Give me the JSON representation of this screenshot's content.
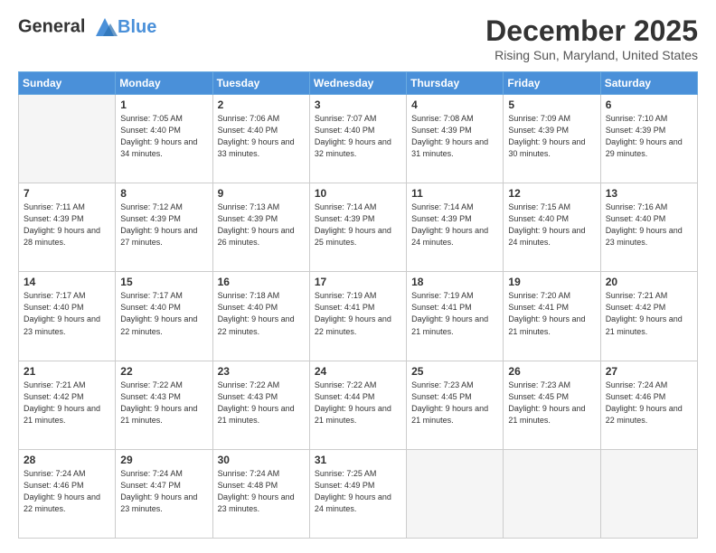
{
  "header": {
    "logo_line1": "General",
    "logo_line2": "Blue",
    "month_title": "December 2025",
    "location": "Rising Sun, Maryland, United States"
  },
  "weekdays": [
    "Sunday",
    "Monday",
    "Tuesday",
    "Wednesday",
    "Thursday",
    "Friday",
    "Saturday"
  ],
  "weeks": [
    [
      {
        "day": "",
        "empty": true
      },
      {
        "day": "1",
        "sunrise": "7:05 AM",
        "sunset": "4:40 PM",
        "daylight": "9 hours and 34 minutes."
      },
      {
        "day": "2",
        "sunrise": "7:06 AM",
        "sunset": "4:40 PM",
        "daylight": "9 hours and 33 minutes."
      },
      {
        "day": "3",
        "sunrise": "7:07 AM",
        "sunset": "4:40 PM",
        "daylight": "9 hours and 32 minutes."
      },
      {
        "day": "4",
        "sunrise": "7:08 AM",
        "sunset": "4:39 PM",
        "daylight": "9 hours and 31 minutes."
      },
      {
        "day": "5",
        "sunrise": "7:09 AM",
        "sunset": "4:39 PM",
        "daylight": "9 hours and 30 minutes."
      },
      {
        "day": "6",
        "sunrise": "7:10 AM",
        "sunset": "4:39 PM",
        "daylight": "9 hours and 29 minutes."
      }
    ],
    [
      {
        "day": "7",
        "sunrise": "7:11 AM",
        "sunset": "4:39 PM",
        "daylight": "9 hours and 28 minutes."
      },
      {
        "day": "8",
        "sunrise": "7:12 AM",
        "sunset": "4:39 PM",
        "daylight": "9 hours and 27 minutes."
      },
      {
        "day": "9",
        "sunrise": "7:13 AM",
        "sunset": "4:39 PM",
        "daylight": "9 hours and 26 minutes."
      },
      {
        "day": "10",
        "sunrise": "7:14 AM",
        "sunset": "4:39 PM",
        "daylight": "9 hours and 25 minutes."
      },
      {
        "day": "11",
        "sunrise": "7:14 AM",
        "sunset": "4:39 PM",
        "daylight": "9 hours and 24 minutes."
      },
      {
        "day": "12",
        "sunrise": "7:15 AM",
        "sunset": "4:40 PM",
        "daylight": "9 hours and 24 minutes."
      },
      {
        "day": "13",
        "sunrise": "7:16 AM",
        "sunset": "4:40 PM",
        "daylight": "9 hours and 23 minutes."
      }
    ],
    [
      {
        "day": "14",
        "sunrise": "7:17 AM",
        "sunset": "4:40 PM",
        "daylight": "9 hours and 23 minutes."
      },
      {
        "day": "15",
        "sunrise": "7:17 AM",
        "sunset": "4:40 PM",
        "daylight": "9 hours and 22 minutes."
      },
      {
        "day": "16",
        "sunrise": "7:18 AM",
        "sunset": "4:40 PM",
        "daylight": "9 hours and 22 minutes."
      },
      {
        "day": "17",
        "sunrise": "7:19 AM",
        "sunset": "4:41 PM",
        "daylight": "9 hours and 22 minutes."
      },
      {
        "day": "18",
        "sunrise": "7:19 AM",
        "sunset": "4:41 PM",
        "daylight": "9 hours and 21 minutes."
      },
      {
        "day": "19",
        "sunrise": "7:20 AM",
        "sunset": "4:41 PM",
        "daylight": "9 hours and 21 minutes."
      },
      {
        "day": "20",
        "sunrise": "7:21 AM",
        "sunset": "4:42 PM",
        "daylight": "9 hours and 21 minutes."
      }
    ],
    [
      {
        "day": "21",
        "sunrise": "7:21 AM",
        "sunset": "4:42 PM",
        "daylight": "9 hours and 21 minutes."
      },
      {
        "day": "22",
        "sunrise": "7:22 AM",
        "sunset": "4:43 PM",
        "daylight": "9 hours and 21 minutes."
      },
      {
        "day": "23",
        "sunrise": "7:22 AM",
        "sunset": "4:43 PM",
        "daylight": "9 hours and 21 minutes."
      },
      {
        "day": "24",
        "sunrise": "7:22 AM",
        "sunset": "4:44 PM",
        "daylight": "9 hours and 21 minutes."
      },
      {
        "day": "25",
        "sunrise": "7:23 AM",
        "sunset": "4:45 PM",
        "daylight": "9 hours and 21 minutes."
      },
      {
        "day": "26",
        "sunrise": "7:23 AM",
        "sunset": "4:45 PM",
        "daylight": "9 hours and 21 minutes."
      },
      {
        "day": "27",
        "sunrise": "7:24 AM",
        "sunset": "4:46 PM",
        "daylight": "9 hours and 22 minutes."
      }
    ],
    [
      {
        "day": "28",
        "sunrise": "7:24 AM",
        "sunset": "4:46 PM",
        "daylight": "9 hours and 22 minutes."
      },
      {
        "day": "29",
        "sunrise": "7:24 AM",
        "sunset": "4:47 PM",
        "daylight": "9 hours and 23 minutes."
      },
      {
        "day": "30",
        "sunrise": "7:24 AM",
        "sunset": "4:48 PM",
        "daylight": "9 hours and 23 minutes."
      },
      {
        "day": "31",
        "sunrise": "7:25 AM",
        "sunset": "4:49 PM",
        "daylight": "9 hours and 24 minutes."
      },
      {
        "day": "",
        "empty": true
      },
      {
        "day": "",
        "empty": true
      },
      {
        "day": "",
        "empty": true
      }
    ]
  ]
}
